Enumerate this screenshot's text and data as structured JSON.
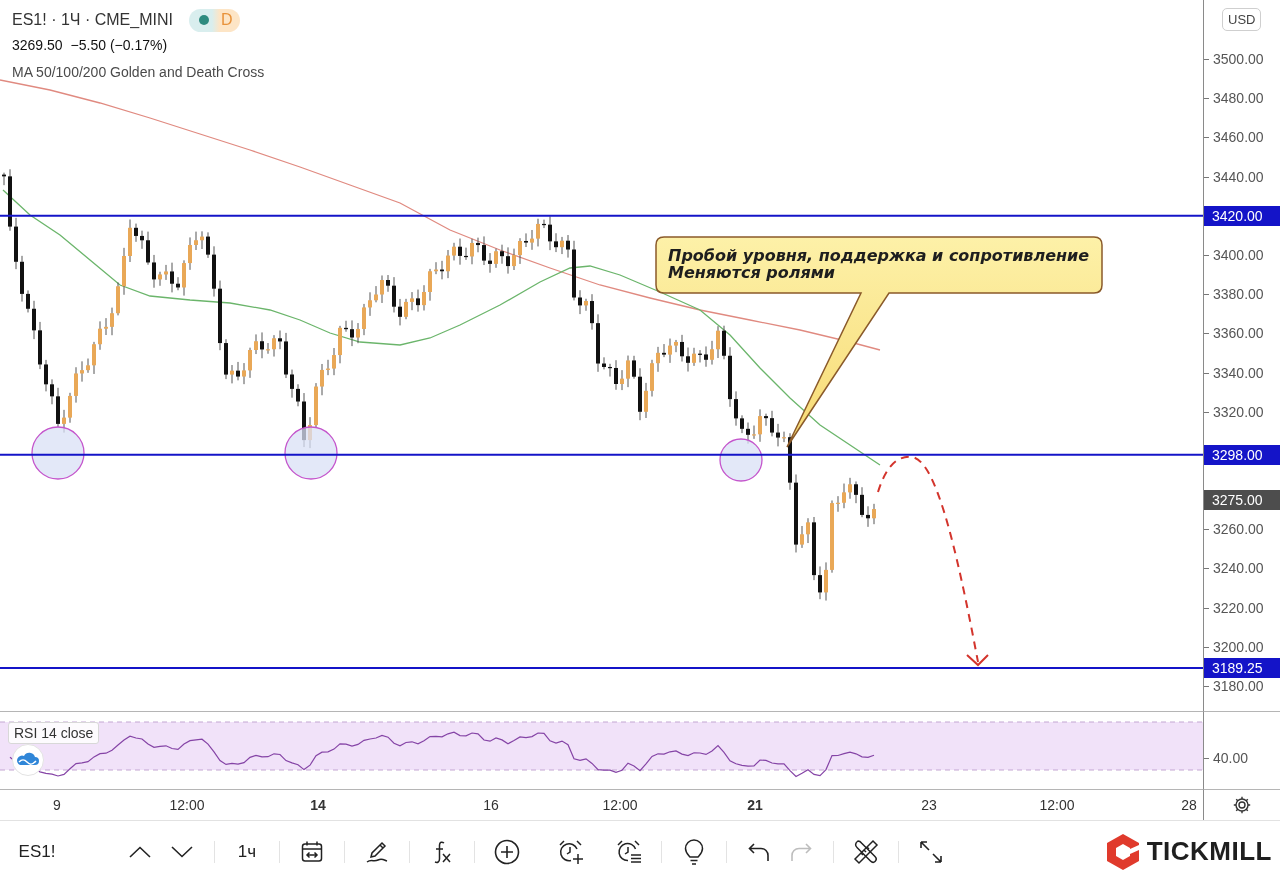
{
  "legend": {
    "title": "ES1! · 1Ч · CME_MINI",
    "status_badge": "D",
    "price": "3269.50",
    "change": "−5.50 (−0.17%)",
    "indicator": "MA 50/100/200 Golden and Death Cross"
  },
  "price_axis": {
    "currency": "USD",
    "ticks": [
      "3500.00",
      "3480.00",
      "3460.00",
      "3440.00",
      "3400.00",
      "3380.00",
      "3360.00",
      "3340.00",
      "3320.00",
      "3260.00",
      "3240.00",
      "3220.00",
      "3200.00",
      "3180.00"
    ]
  },
  "price_labels": [
    {
      "text": "3420.00",
      "kind": "level",
      "color": "#1414c8"
    },
    {
      "text": "3298.00",
      "kind": "level",
      "color": "#1414c8"
    },
    {
      "text": "3275.00",
      "kind": "current",
      "color": "#4d4d4d"
    },
    {
      "text": "3189.25",
      "kind": "level",
      "color": "#1414c8"
    }
  ],
  "callout": {
    "text": "Пробой уровня, поддержка и сопротивление\nМеняются ролями"
  },
  "rsi": {
    "label": "RSI 14 close",
    "tick": "40.00"
  },
  "time_axis": [
    {
      "label": "9",
      "major": false
    },
    {
      "label": "12:00",
      "major": false
    },
    {
      "label": "14",
      "major": true
    },
    {
      "label": "16",
      "major": false
    },
    {
      "label": "12:00",
      "major": false
    },
    {
      "label": "21",
      "major": true
    },
    {
      "label": "23",
      "major": false
    },
    {
      "label": "12:00",
      "major": false
    },
    {
      "label": "28",
      "major": false
    }
  ],
  "toolbar": {
    "symbol": "ES1!",
    "interval": "1ч",
    "undo": {
      "disabled": false
    },
    "redo": {
      "disabled": true
    }
  },
  "brand": {
    "name": "TICKMILL"
  }
}
